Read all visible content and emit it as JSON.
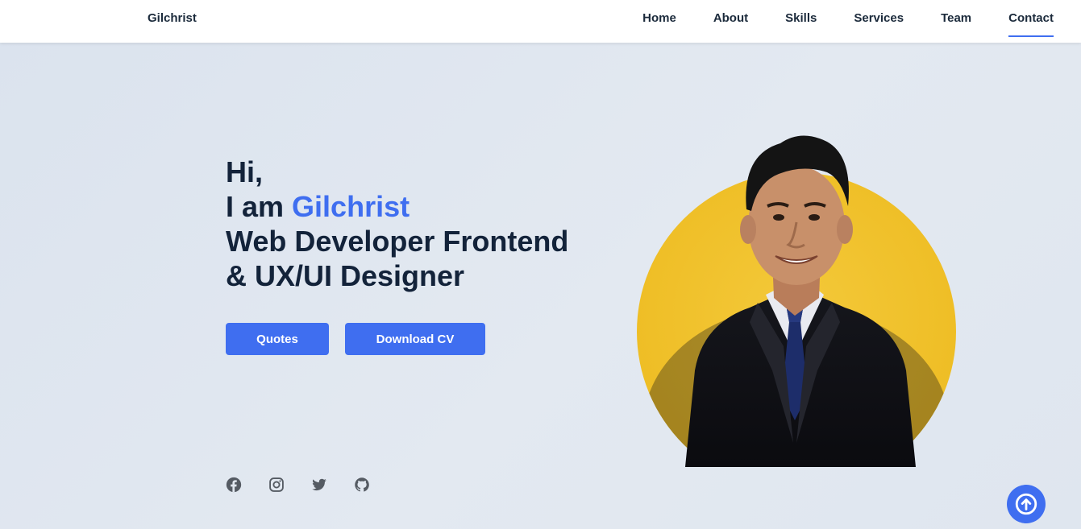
{
  "nav": {
    "brand": "Gilchrist",
    "links": [
      {
        "label": "Home"
      },
      {
        "label": "About"
      },
      {
        "label": "Skills"
      },
      {
        "label": "Services"
      },
      {
        "label": "Team"
      },
      {
        "label": "Contact",
        "active": true
      }
    ]
  },
  "hero": {
    "greeting": "Hi,",
    "intro_prefix": "I am ",
    "name": "Gilchrist",
    "role_line1": "Web Developer Frontend",
    "role_line2": "& UX/UI Designer",
    "buttons": {
      "quotes": "Quotes",
      "download_cv": "Download CV"
    },
    "socials": [
      "facebook-icon",
      "instagram-icon",
      "twitter-icon",
      "github-icon"
    ]
  },
  "scroll_top_icon": "arrow-up-circle-icon",
  "colors": {
    "accent": "#3f6ef0",
    "heading": "#13233a",
    "background": "#e1e7ef",
    "portrait_circle": "#f2c12e",
    "icon_gray": "#555b63"
  }
}
